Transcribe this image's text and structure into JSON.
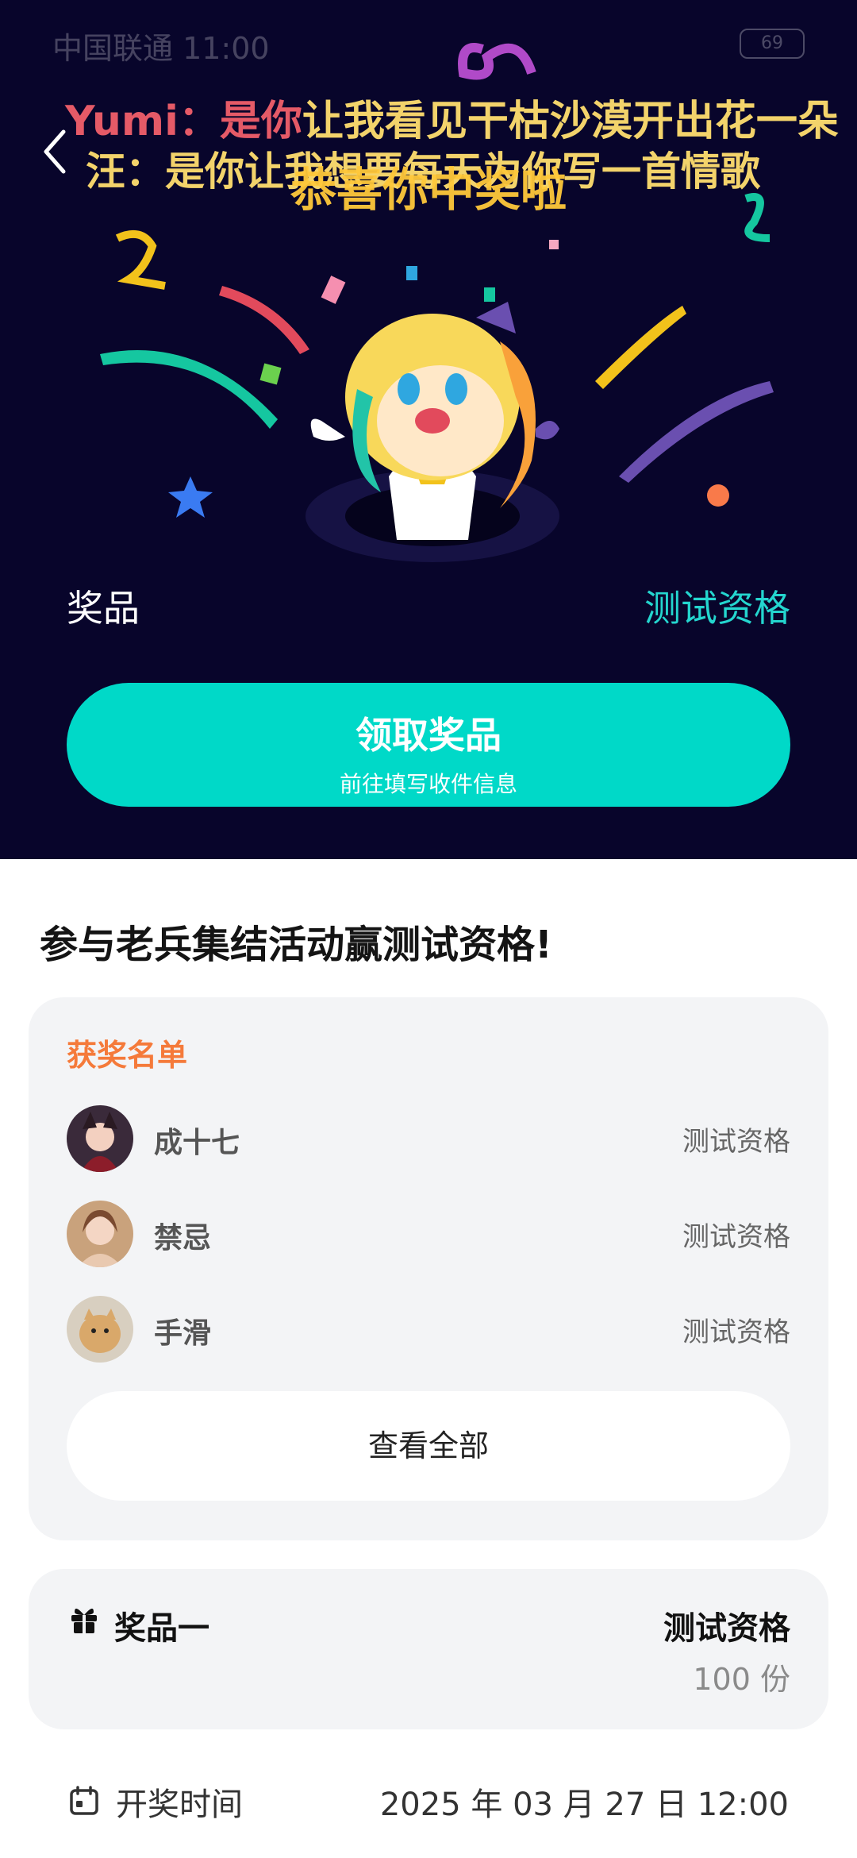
{
  "status_bar": {
    "carrier_time": "中国联通 11:00",
    "battery": "69"
  },
  "danmu": [
    {
      "name": "Yumi：是你",
      "text": "让我看见干枯沙漠开出花一朵"
    },
    {
      "name": "汪：",
      "text": "是你让我想要每天为你写一首情歌"
    }
  ],
  "hero": {
    "title": "恭喜你中奖啦",
    "prize_label": "奖品",
    "prize_value": "测试资格",
    "claim_button": {
      "label": "领取奖品",
      "sublabel": "前往填写收件信息"
    }
  },
  "section": {
    "title": "参与老兵集结活动赢测试资格!"
  },
  "winners": {
    "title": "获奖名单",
    "rows": [
      {
        "name": "成十七",
        "prize": "测试资格"
      },
      {
        "name": "禁忌",
        "prize": "测试资格"
      },
      {
        "name": "手滑",
        "prize": "测试资格"
      }
    ],
    "view_all": "查看全部"
  },
  "prize_card": {
    "title": "奖品一",
    "name": "测试资格",
    "quantity": "100 份"
  },
  "draw": {
    "label": "开奖时间",
    "time": "2025 年 03 月 27 日 12:00"
  },
  "colors": {
    "hero_bg": "#08052b",
    "accent": "#00d9c8",
    "orange": "#f57a3a",
    "gold": "#ffc83a"
  }
}
